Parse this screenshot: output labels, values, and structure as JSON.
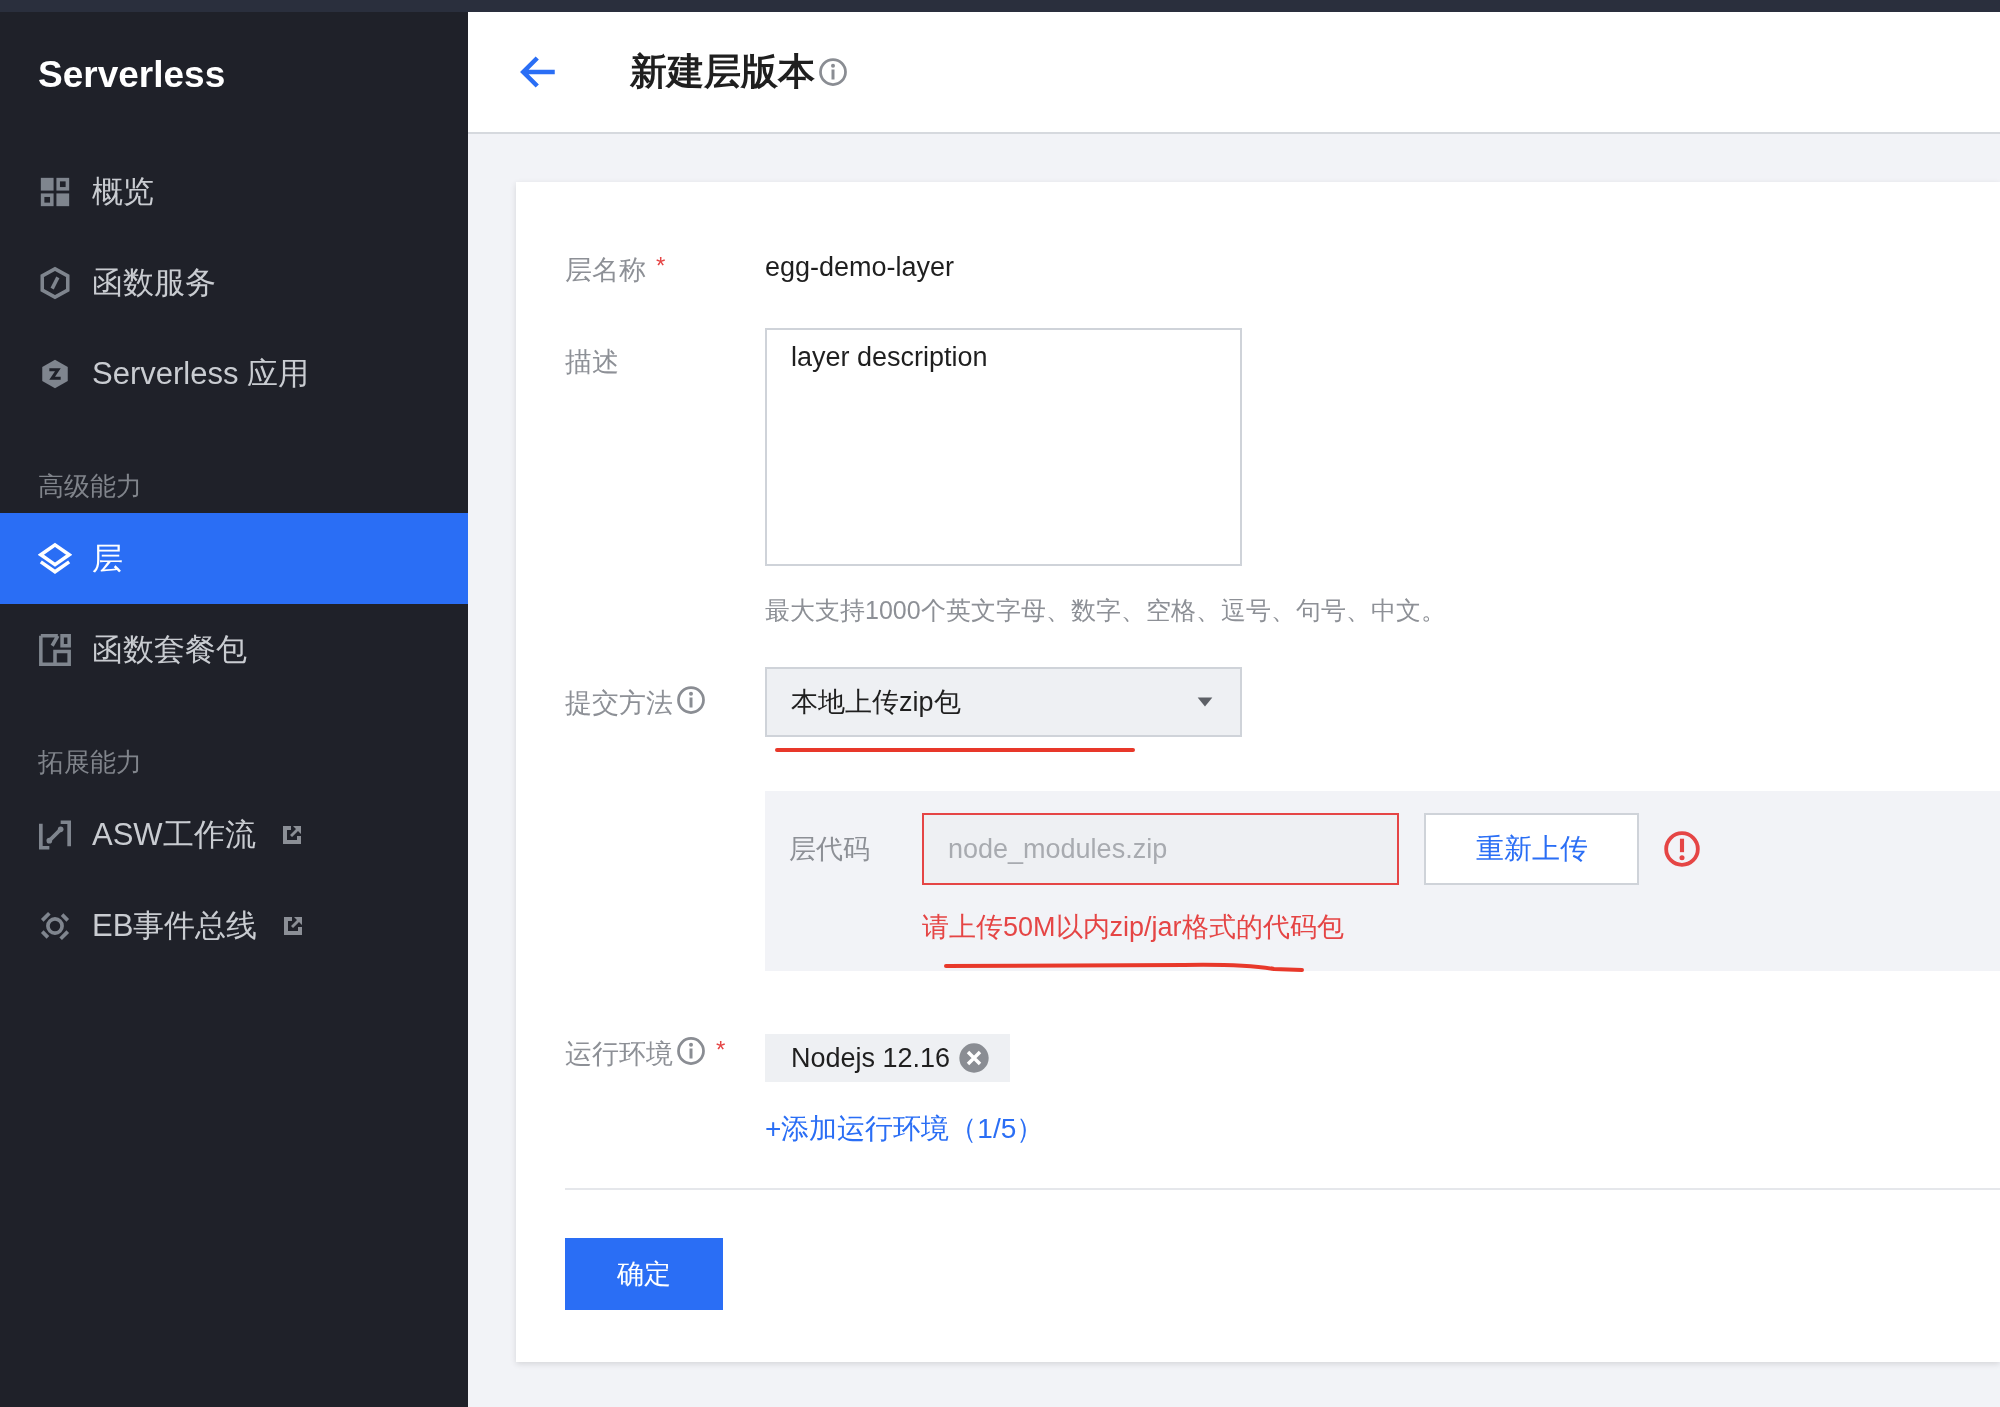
{
  "sidebar": {
    "title": "Serverless",
    "items": [
      {
        "kind": "item",
        "label": "概览",
        "selected": false
      },
      {
        "kind": "item",
        "label": "函数服务",
        "selected": false
      },
      {
        "kind": "item",
        "label": "Serverless 应用",
        "selected": false
      },
      {
        "kind": "group",
        "label": "高级能力"
      },
      {
        "kind": "item",
        "label": "层",
        "selected": true
      },
      {
        "kind": "item",
        "label": "函数套餐包",
        "selected": false
      },
      {
        "kind": "group",
        "label": "拓展能力"
      },
      {
        "kind": "item",
        "label": "ASW工作流",
        "selected": false,
        "external": true
      },
      {
        "kind": "item",
        "label": "EB事件总线",
        "selected": false,
        "external": true
      }
    ]
  },
  "header": {
    "title": "新建层版本"
  },
  "form": {
    "fields": [
      {
        "kind": "text",
        "label": "层名称",
        "required_mark": "*",
        "value": "egg-demo-layer"
      },
      {
        "kind": "textarea",
        "label": "描述",
        "value": "layer description",
        "hint": "最大支持1000个英文字母、数字、空格、逗号、句号、中文。"
      },
      {
        "kind": "select",
        "label": "提交方法",
        "info": true,
        "value": "本地上传zip包",
        "annotated": true
      },
      {
        "kind": "upload",
        "label": "层代码",
        "placeholder": "node_modules.zip",
        "button": "重新上传",
        "invalid": true,
        "error": "请上传50M以内zip/jar格式的代码包",
        "annotated": true
      },
      {
        "kind": "tags",
        "label": "运行环境",
        "required_mark": "*",
        "info": true,
        "tags": [
          "Nodejs 12.16"
        ],
        "add_link": "+添加运行环境（1/5）"
      }
    ],
    "submit": "确定"
  }
}
